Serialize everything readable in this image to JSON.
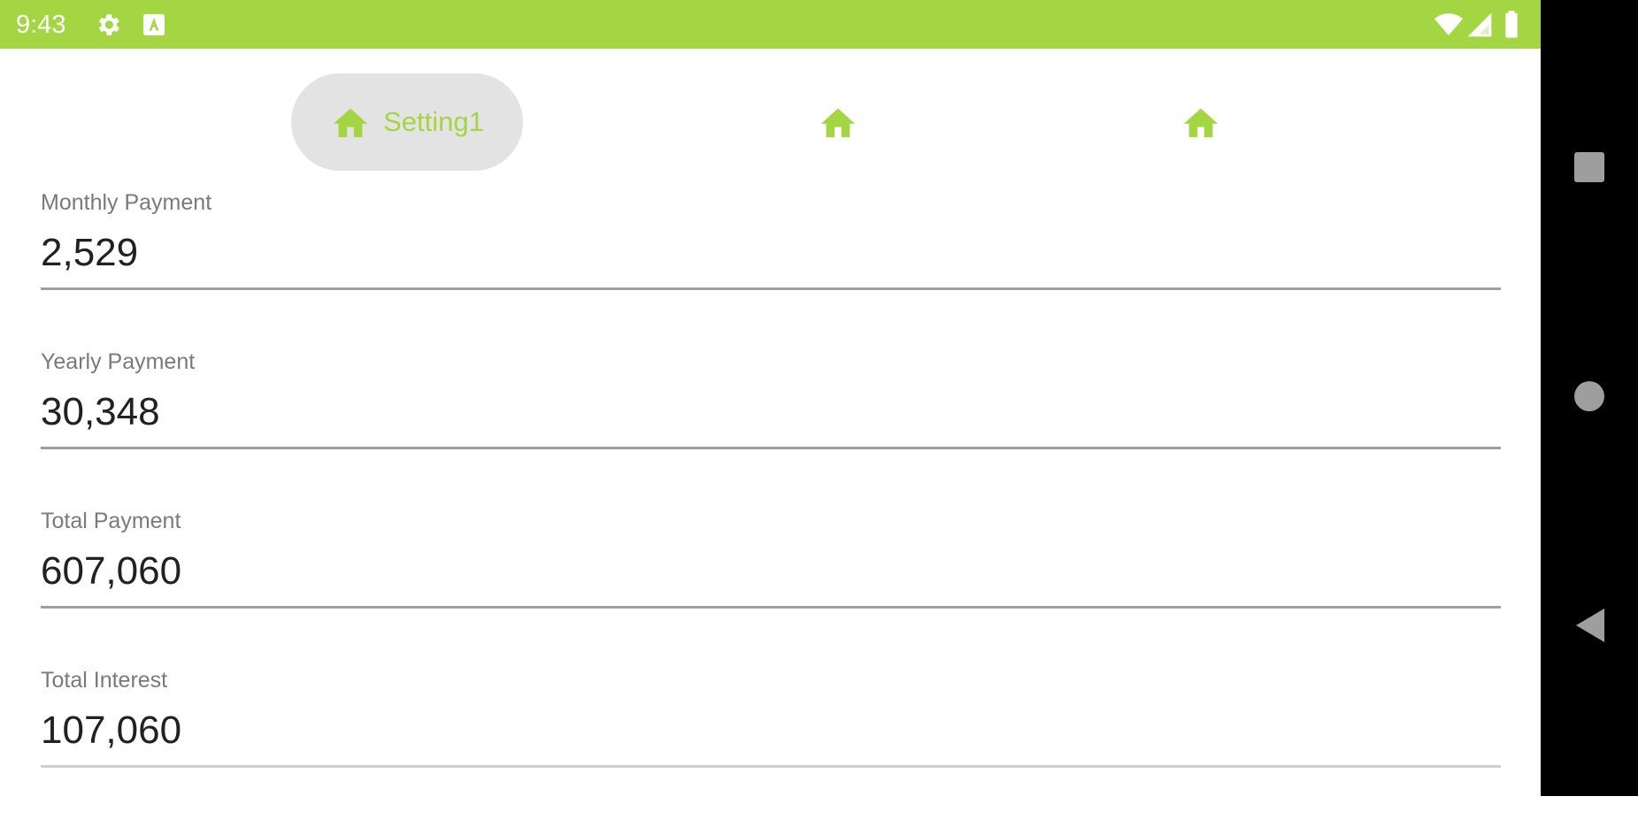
{
  "status_bar": {
    "time": "9:43",
    "icons": [
      "gear-icon",
      "a-box-icon",
      "wifi-icon",
      "cell-signal-icon",
      "battery-icon"
    ],
    "color": "#a4d543"
  },
  "tabs": [
    {
      "label": "Setting1",
      "icon": "home-icon",
      "active": true
    },
    {
      "label": "",
      "icon": "home-icon",
      "active": false
    },
    {
      "label": "",
      "icon": "home-icon",
      "active": false
    }
  ],
  "fields": {
    "monthly_payment": {
      "label": "Monthly Payment",
      "value": "2,529"
    },
    "yearly_payment": {
      "label": "Yearly Payment",
      "value": "30,348"
    },
    "total_payment": {
      "label": "Total Payment",
      "value": "607,060"
    },
    "total_interest": {
      "label": "Total Interest",
      "value": "107,060"
    }
  },
  "nav": {
    "buttons": [
      "recents-square-icon",
      "home-circle-icon",
      "back-triangle-icon"
    ]
  },
  "colors": {
    "accent": "#a4d543"
  }
}
